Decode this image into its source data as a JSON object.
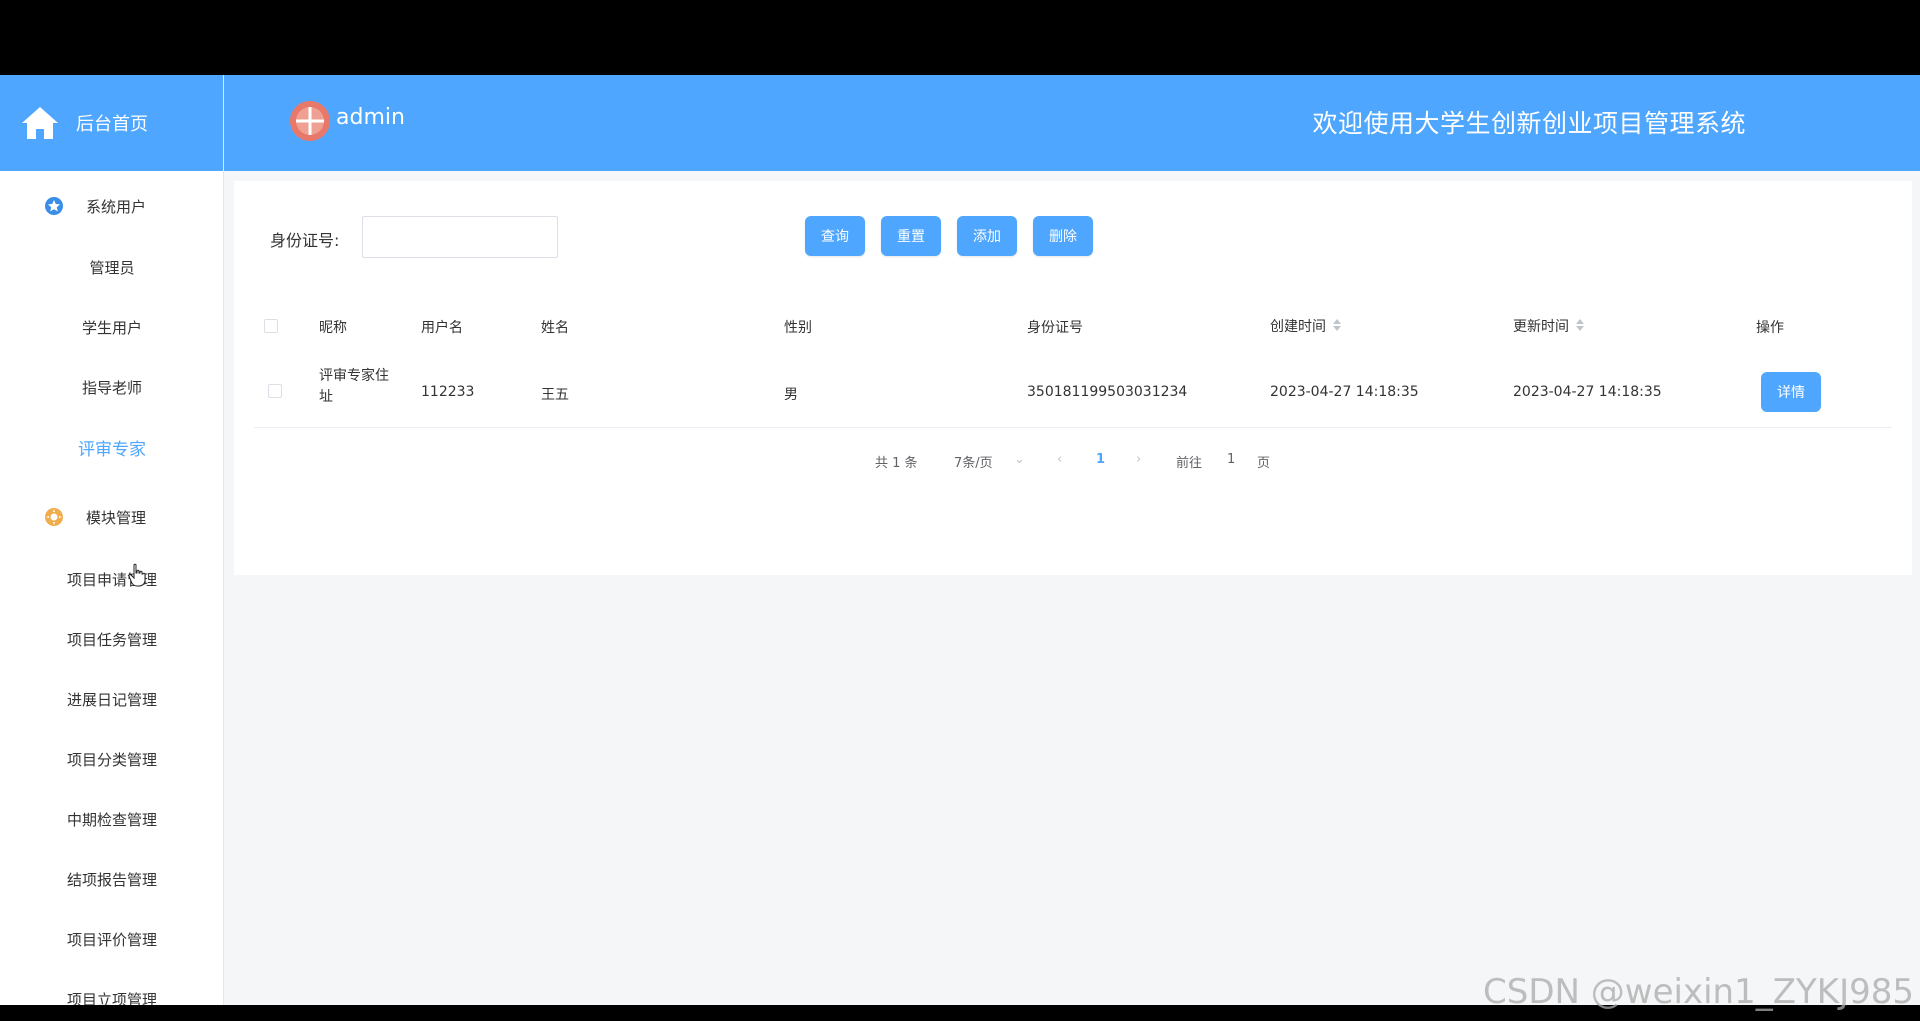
{
  "sidebar": {
    "home_label": "后台首页",
    "groups": [
      {
        "label": "系统用户",
        "icon": "star-icon"
      },
      {
        "label": "模块管理",
        "icon": "gear-icon"
      }
    ],
    "user_items": [
      "管理员",
      "学生用户",
      "指导老师",
      "评审专家"
    ],
    "module_items": [
      "项目申请管理",
      "项目任务管理",
      "进展日记管理",
      "项目分类管理",
      "中期检查管理",
      "结项报告管理",
      "项目评价管理",
      "项目立项管理"
    ],
    "active_item": "评审专家"
  },
  "header": {
    "user_name": "admin",
    "welcome": "欢迎使用大学生创新创业项目管理系统"
  },
  "search": {
    "label": "身份证号:",
    "value": "",
    "placeholder": ""
  },
  "toolbar": {
    "query": "查询",
    "reset": "重置",
    "add": "添加",
    "delete": "删除"
  },
  "table": {
    "columns": [
      "昵称",
      "用户名",
      "姓名",
      "性别",
      "身份证号",
      "创建时间",
      "更新时间",
      "操作"
    ],
    "rows": [
      {
        "nickname_line1": "评审专家住",
        "nickname_line2": "址",
        "username": "112233",
        "name": "王五",
        "gender": "男",
        "id_number": "350181199503031234",
        "created": "2023-04-27 14:18:35",
        "updated": "2023-04-27 14:18:35",
        "action": "详情"
      }
    ]
  },
  "pagination": {
    "total": "共 1 条",
    "page_size": "7条/页",
    "current": "1",
    "goto_prefix": "前往",
    "goto_value": "1",
    "goto_suffix": "页"
  },
  "watermark": "CSDN @weixin1_ZYKJ985",
  "colors": {
    "accent": "#4ea6ff",
    "background": "#f5f6f8"
  }
}
